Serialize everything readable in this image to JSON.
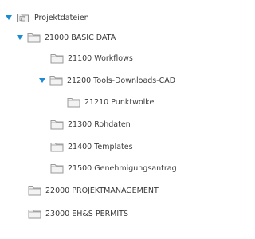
{
  "colors": {
    "accent": "#1b8ad4",
    "folder_stroke": "#9a9a9a",
    "folder_fill": "#f3f3f3",
    "text": "#3a3a3a"
  },
  "tree": {
    "root": {
      "label": "Projektdateien",
      "icon": "project-folder-icon",
      "expanded": true
    },
    "items": [
      {
        "label": "21000 BASIC DATA",
        "icon": "folder-icon",
        "expanded": true
      },
      {
        "label": "21100 Workflows",
        "icon": "folder-icon"
      },
      {
        "label": "21200 Tools-Downloads-CAD",
        "icon": "folder-icon",
        "expanded": true
      },
      {
        "label": "21210 Punktwolke",
        "icon": "folder-icon"
      },
      {
        "label": "21300 Rohdaten",
        "icon": "folder-icon"
      },
      {
        "label": "21400 Templates",
        "icon": "folder-icon"
      },
      {
        "label": "21500 Genehmigungsantrag",
        "icon": "folder-icon"
      },
      {
        "label": "22000 PROJEKTMANAGEMENT",
        "icon": "folder-icon"
      },
      {
        "label": "23000 EH&S PERMITS",
        "icon": "folder-icon"
      }
    ]
  }
}
